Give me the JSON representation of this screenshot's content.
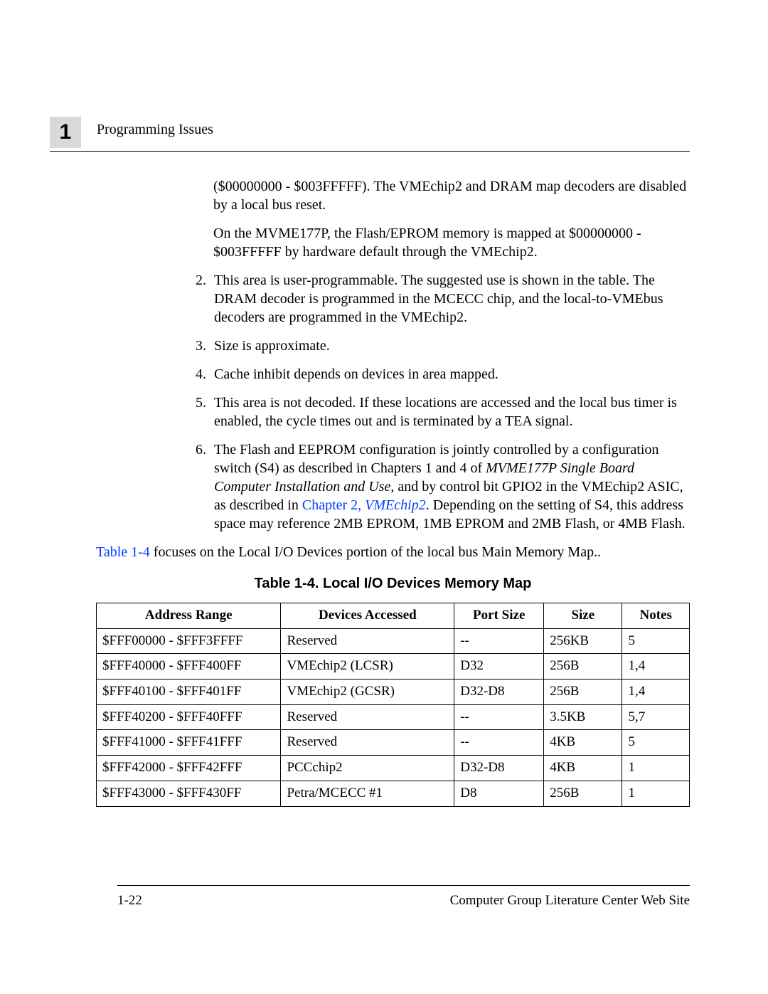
{
  "header": {
    "chapter_number": "1",
    "running_head": "Programming Issues"
  },
  "body": {
    "cont1": "($00000000 - $003FFFFF). The VMEchip2 and DRAM map decoders are disabled by a local bus reset.",
    "cont2": "On the MVME177P, the Flash/EPROM memory is mapped at $00000000 - $003FFFFF by hardware default through the VMEchip2.",
    "note2_num": "2.",
    "note2": "This area is user-programmable. The suggested use is shown in the table. The DRAM decoder is programmed in the MCECC chip, and the local-to-VMEbus decoders are programmed in the VMEchip2.",
    "note3_num": "3.",
    "note3": "Size is approximate.",
    "note4_num": "4.",
    "note4": "Cache inhibit depends on devices in area mapped.",
    "note5_num": "5.",
    "note5": "This area is not decoded. If these locations are accessed and the local bus timer is enabled, the cycle times out and is terminated by a TEA signal.",
    "note6_num": "6.",
    "note6_a": "The Flash and EEPROM configuration is jointly controlled by a configuration switch (S4) as described in Chapters 1 and 4  of ",
    "note6_italic": "MVME177P Single Board Computer Installation and Use",
    "note6_b": ", and by control bit GPIO2 in the VMEchip2 ASIC, as described in ",
    "note6_link": "Chapter 2, ",
    "note6_link_italic": "VMEchip2",
    "note6_c": ". Depending on the setting of S4, this address space may reference 2MB EPROM, 1MB EPROM and 2MB Flash, or 4MB Flash.",
    "para_link": "Table 1-4",
    "para_rest": " focuses on the Local I/O Devices portion of the local bus Main Memory Map.."
  },
  "table": {
    "caption": "Table 1-4.  Local I/O Devices Memory Map",
    "headers": [
      "Address Range",
      "Devices Accessed",
      "Port Size",
      "Size",
      "Notes"
    ],
    "rows": [
      [
        "$FFF00000 - $FFF3FFFF",
        "Reserved",
        "--",
        "256KB",
        "5"
      ],
      [
        "$FFF40000 - $FFF400FF",
        "VMEchip2 (LCSR)",
        "D32",
        "256B",
        "1,4"
      ],
      [
        "$FFF40100 - $FFF401FF",
        "VMEchip2 (GCSR)",
        "D32-D8",
        "256B",
        "1,4"
      ],
      [
        "$FFF40200 - $FFF40FFF",
        "Reserved",
        "--",
        "3.5KB",
        "5,7"
      ],
      [
        "$FFF41000 - $FFF41FFF",
        "Reserved",
        "--",
        "4KB",
        "5"
      ],
      [
        "$FFF42000 - $FFF42FFF",
        "PCCchip2",
        "D32-D8",
        "4KB",
        "1"
      ],
      [
        "$FFF43000 - $FFF430FF",
        "Petra/MCECC #1",
        "D8",
        "256B",
        "1"
      ]
    ]
  },
  "footer": {
    "page_number": "1-22",
    "site": "Computer Group Literature Center Web Site"
  }
}
